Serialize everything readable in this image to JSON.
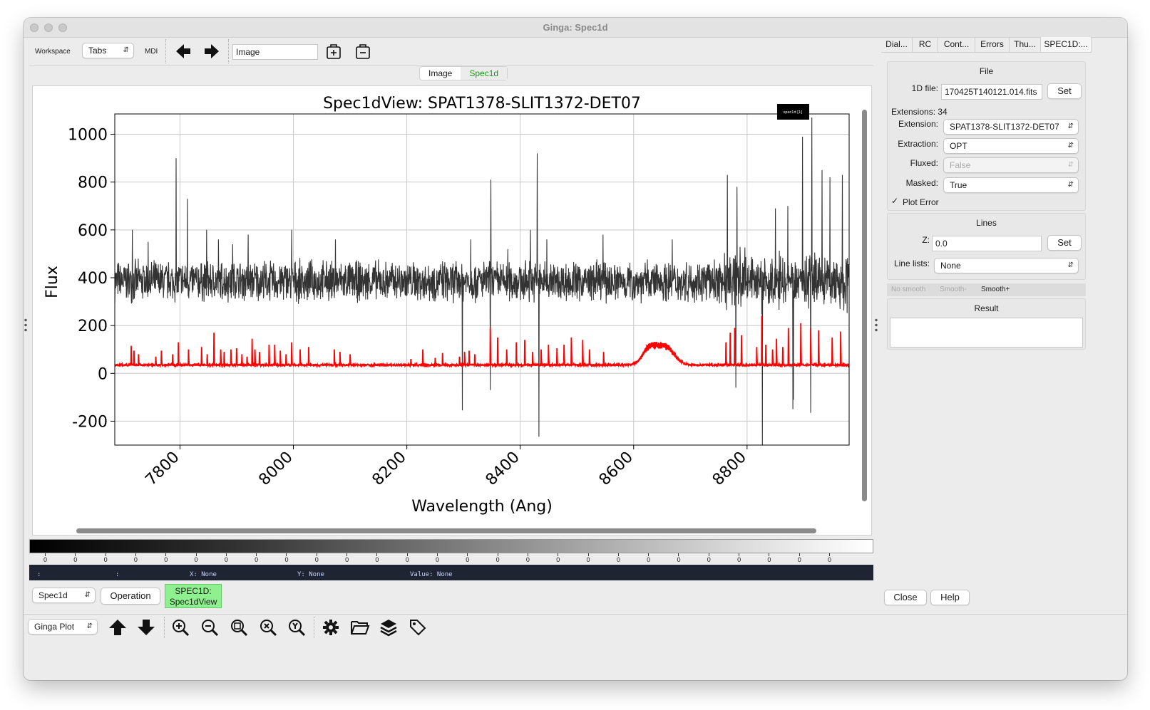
{
  "window": {
    "title": "Ginga: Spec1d"
  },
  "toolbar": {
    "workspace_label": "Workspace",
    "workspace_value": "Tabs",
    "mdi_label": "MDI",
    "channel_input": "Image"
  },
  "view_tabs": [
    "Image",
    "Spec1d"
  ],
  "chart_data": {
    "type": "line",
    "title": "Spec1dView: SPAT1378-SLIT1372-DET07",
    "xlabel": "Wavelength (Ang)",
    "ylabel": "Flux",
    "xlim": [
      7685,
      8980
    ],
    "ylim": [
      -300,
      1085
    ],
    "xticks": [
      7800,
      8000,
      8200,
      8400,
      8600,
      8800
    ],
    "yticks": [
      -200,
      0,
      200,
      400,
      600,
      800,
      1000
    ],
    "legend_text": "spec1d [1]",
    "legend_placement": "top-right",
    "grid": true,
    "series": [
      {
        "color": "#333333",
        "baseline": 385,
        "noise": 70,
        "spikes": [
          [
            7716,
            600
          ],
          [
            7744,
            550
          ],
          [
            7793,
            900
          ],
          [
            7813,
            730
          ],
          [
            7847,
            600
          ],
          [
            7868,
            560
          ],
          [
            7893,
            540
          ],
          [
            7920,
            580
          ],
          [
            7997,
            600
          ],
          [
            8074,
            560
          ],
          [
            8313,
            560
          ],
          [
            8348,
            810
          ],
          [
            8378,
            520
          ],
          [
            8418,
            600
          ],
          [
            8430,
            920
          ],
          [
            8447,
            560
          ],
          [
            8546,
            580
          ],
          [
            8668,
            560
          ],
          [
            8765,
            830
          ],
          [
            8782,
            780
          ],
          [
            8827,
            970
          ],
          [
            8850,
            690
          ],
          [
            8898,
            990
          ],
          [
            8914,
            1070
          ],
          [
            8932,
            850
          ],
          [
            8946,
            820
          ],
          [
            8968,
            830
          ],
          [
            8872,
            700
          ]
        ],
        "dips": [
          [
            8298,
            -155
          ],
          [
            8347,
            -70
          ],
          [
            8433,
            -265
          ],
          [
            8780,
            -60
          ],
          [
            8827,
            -300
          ],
          [
            8881,
            -150
          ],
          [
            8882,
            -110
          ],
          [
            8912,
            -165
          ]
        ]
      },
      {
        "color": "#ff0000",
        "baseline": 35,
        "noise": 4,
        "spikes": [
          [
            7714,
            115
          ],
          [
            7719,
            95
          ],
          [
            7727,
            80
          ],
          [
            7757,
            70
          ],
          [
            7767,
            95
          ],
          [
            7787,
            80
          ],
          [
            7797,
            130
          ],
          [
            7815,
            100
          ],
          [
            7838,
            110
          ],
          [
            7848,
            80
          ],
          [
            7860,
            170
          ],
          [
            7872,
            100
          ],
          [
            7878,
            90
          ],
          [
            7890,
            100
          ],
          [
            7900,
            105
          ],
          [
            7909,
            80
          ],
          [
            7918,
            70
          ],
          [
            7927,
            145
          ],
          [
            7932,
            100
          ],
          [
            7940,
            90
          ],
          [
            7957,
            120
          ],
          [
            7967,
            120
          ],
          [
            7977,
            95
          ],
          [
            7987,
            80
          ],
          [
            7997,
            130
          ],
          [
            8012,
            100
          ],
          [
            8027,
            110
          ],
          [
            8072,
            100
          ],
          [
            8082,
            90
          ],
          [
            8100,
            80
          ],
          [
            8207,
            60
          ],
          [
            8228,
            100
          ],
          [
            8250,
            65
          ],
          [
            8263,
            85
          ],
          [
            8293,
            70
          ],
          [
            8302,
            90
          ],
          [
            8310,
            95
          ],
          [
            8320,
            80
          ],
          [
            8347,
            190
          ],
          [
            8360,
            150
          ],
          [
            8376,
            100
          ],
          [
            8393,
            130
          ],
          [
            8408,
            140
          ],
          [
            8422,
            90
          ],
          [
            8437,
            100
          ],
          [
            8450,
            120
          ],
          [
            8465,
            105
          ],
          [
            8477,
            120
          ],
          [
            8490,
            150
          ],
          [
            8510,
            140
          ],
          [
            8522,
            100
          ],
          [
            8547,
            90
          ],
          [
            8763,
            130
          ],
          [
            8770,
            170
          ],
          [
            8778,
            190
          ],
          [
            8790,
            160
          ],
          [
            8817,
            110
          ],
          [
            8826,
            240
          ],
          [
            8833,
            120
          ],
          [
            8845,
            100
          ],
          [
            8852,
            145
          ],
          [
            8863,
            110
          ],
          [
            8873,
            190
          ],
          [
            8895,
            210
          ],
          [
            8912,
            190
          ],
          [
            8926,
            180
          ],
          [
            8950,
            150
          ],
          [
            8965,
            175
          ]
        ],
        "bumps": [
          [
            8628,
            75,
            12
          ],
          [
            8656,
            85,
            15
          ]
        ]
      }
    ]
  },
  "colorbar": {
    "tick_labels": [
      "0",
      "0",
      "0",
      "0",
      "0",
      "0",
      "0",
      "0",
      "0",
      "0",
      "0",
      "0",
      "0",
      "0",
      "0",
      "0",
      "0",
      "0",
      "0",
      "0",
      "0",
      "0",
      "0",
      "0",
      "0",
      "0",
      "0"
    ]
  },
  "readout": {
    "sep1": ":",
    "sep2": ":",
    "x": "X: None",
    "y": "Y: None",
    "value": "Value: None"
  },
  "operations": {
    "channel_select": "Spec1d",
    "operation_button": "Operation",
    "plugin_button": "SPEC1D:\nSpec1dView"
  },
  "bottom": {
    "plot_select": "Ginga Plot"
  },
  "right": {
    "tabs": [
      "Dial...",
      "RC",
      "Cont...",
      "Errors",
      "Thu...",
      "SPEC1D:..."
    ],
    "file": {
      "heading": "File",
      "file_label": "1D file:",
      "file_value": "170425T140121.014.fits",
      "set_label": "Set",
      "extensions_label": "Extensions: 34",
      "extension_label": "Extension:",
      "extension_value": "SPAT1378-SLIT1372-DET07",
      "extraction_label": "Extraction:",
      "extraction_value": "OPT",
      "fluxed_label": "Fluxed:",
      "fluxed_value": "False",
      "masked_label": "Masked:",
      "masked_value": "True",
      "plot_error_label": "Plot Error"
    },
    "lines": {
      "heading": "Lines",
      "z_label": "Z:",
      "z_value": "0.0",
      "set_label": "Set",
      "line_lists_label": "Line lists:",
      "line_lists_value": "None"
    },
    "smooth": [
      "No smooth",
      "Smooth-",
      "Smooth+"
    ],
    "result_heading": "Result",
    "close_label": "Close",
    "help_label": "Help"
  }
}
